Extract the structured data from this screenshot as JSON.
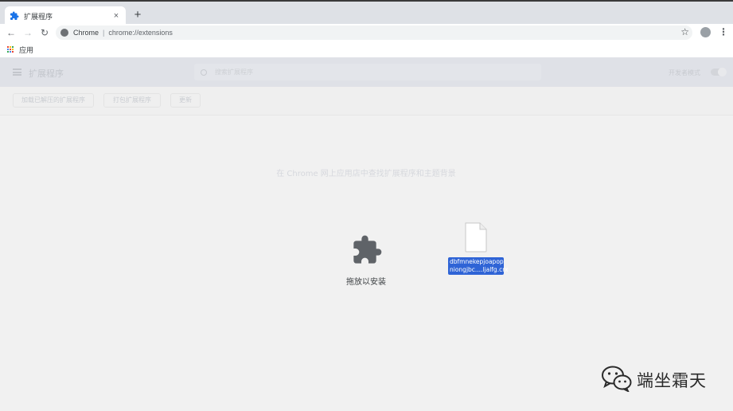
{
  "browser": {
    "tab": {
      "title": "扩展程序",
      "close_symbol": "×"
    },
    "new_tab_symbol": "+",
    "nav": {
      "back": "←",
      "forward": "→",
      "reload": "↻"
    },
    "omnibox": {
      "origin": "Chrome",
      "separator": "|",
      "url": "chrome://extensions"
    },
    "bookmark_star": "☆",
    "menu_symbol": "⋮",
    "bookmarks": {
      "apps_label": "应用"
    }
  },
  "extensions_page": {
    "title": "扩展程序",
    "search_placeholder": "搜索扩展程序",
    "developer_mode_label": "开发者模式",
    "developer_mode_on": true,
    "actions": {
      "load_unpacked": "加载已解压的扩展程序",
      "pack": "打包扩展程序",
      "update": "更新"
    },
    "store_link": "在 Chrome 网上应用店中查找扩展程序和主题背景"
  },
  "drop_zone": {
    "icon": "puzzle-icon",
    "label": "拖放以安装"
  },
  "dragged_file": {
    "line1": "dbfmnekepjoapop",
    "line2": "niongjbc....ljalfg.crx"
  },
  "watermark": {
    "text": "端坐霜天"
  },
  "colors": {
    "chrome_blue": "#1a73e8",
    "selection_blue": "#2f64d6",
    "puzzle_gray": "#5f6368"
  }
}
